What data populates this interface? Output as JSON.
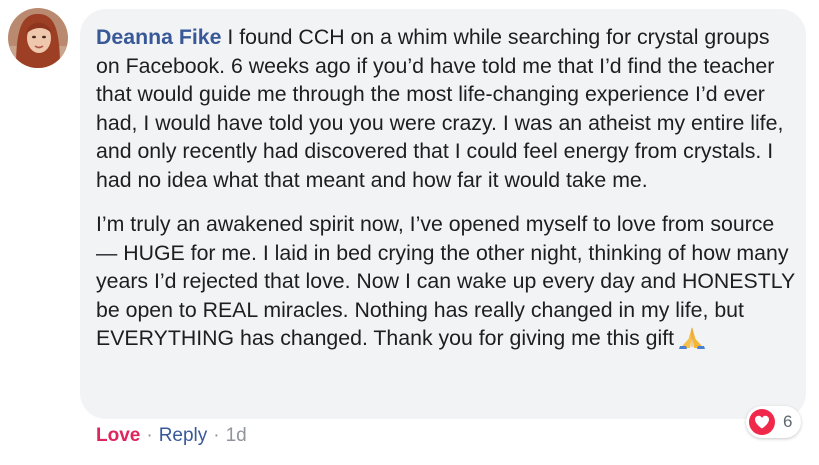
{
  "comment": {
    "author": "Deanna Fike",
    "paragraph_1": "I found CCH on a whim while searching for crystal groups on Facebook. 6 weeks ago if you’d have told me that I’d find the teacher that would guide me through the most life-changing experience I’d ever had, I would have told you you were crazy. I was an atheist my entire life, and only recently had discovered that I could feel energy from crystals. I had no idea what that meant and how far it would take me.",
    "paragraph_2": "I’m truly an awakened spirit now, I’ve opened myself to love from source — HUGE for me. I laid in bed crying the other night, thinking of how many years I’d rejected that love. Now I can wake up every day and HONESTLY be open to REAL miracles. Nothing has really changed in my life, but EVERYTHING has changed. Thank you for giving me this gift",
    "emoji_icon": "folded-hands-icon"
  },
  "reactions": {
    "icon": "heart-icon",
    "count": "6"
  },
  "actions": {
    "love_label": "Love",
    "separator": "·",
    "reply_label": "Reply",
    "timestamp": "1d"
  },
  "colors": {
    "author": "#385898",
    "bubble_bg": "#f2f3f5",
    "love": "#e0245e",
    "heart_bg": "#f0284a",
    "meta": "#90949c"
  }
}
